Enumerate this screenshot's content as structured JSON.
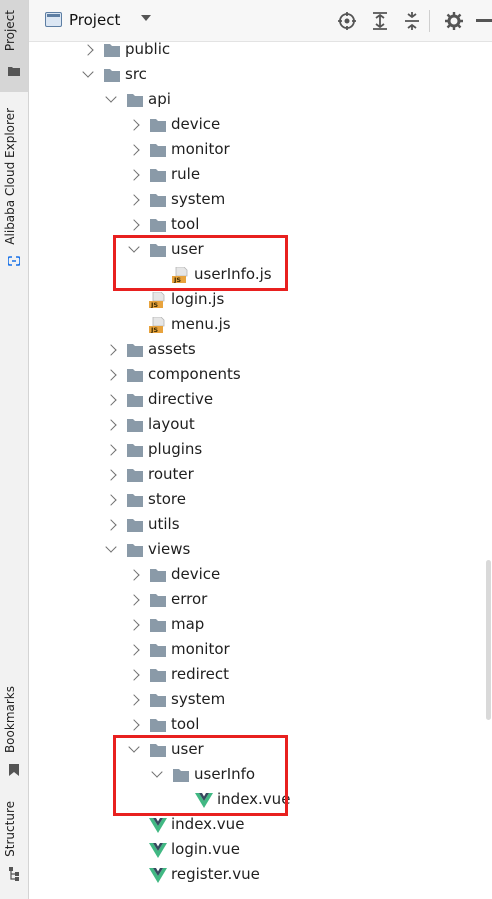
{
  "sidebar": {
    "tabs": [
      {
        "label": "Project",
        "icon": "folder-icon",
        "active": true
      },
      {
        "label": "Alibaba Cloud Explorer",
        "icon": "alibaba-cloud-icon",
        "active": false
      },
      {
        "label": "Bookmarks",
        "icon": "bookmark-icon",
        "active": false
      },
      {
        "label": "Structure",
        "icon": "structure-icon",
        "active": false
      }
    ]
  },
  "header": {
    "title": "Project",
    "actions": [
      "locate-icon",
      "expand-all-icon",
      "collapse-all-icon",
      "settings-icon",
      "hide-icon"
    ]
  },
  "colors": {
    "folder": "#8a9aa8",
    "vue": "#41b883",
    "vue_dark": "#35495e",
    "js_badge": "#e8a33d",
    "highlight": "#e8201f"
  },
  "tree": [
    {
      "label": "public",
      "type": "folder",
      "depth": 0,
      "state": "collapsed"
    },
    {
      "label": "src",
      "type": "folder",
      "depth": 0,
      "state": "expanded"
    },
    {
      "label": "api",
      "type": "folder",
      "depth": 1,
      "state": "expanded"
    },
    {
      "label": "device",
      "type": "folder",
      "depth": 2,
      "state": "collapsed"
    },
    {
      "label": "monitor",
      "type": "folder",
      "depth": 2,
      "state": "collapsed"
    },
    {
      "label": "rule",
      "type": "folder",
      "depth": 2,
      "state": "collapsed"
    },
    {
      "label": "system",
      "type": "folder",
      "depth": 2,
      "state": "collapsed"
    },
    {
      "label": "tool",
      "type": "folder",
      "depth": 2,
      "state": "collapsed"
    },
    {
      "label": "user",
      "type": "folder",
      "depth": 2,
      "state": "expanded"
    },
    {
      "label": "userInfo.js",
      "type": "js",
      "depth": 3,
      "state": "none"
    },
    {
      "label": "login.js",
      "type": "js",
      "depth": 2,
      "state": "none"
    },
    {
      "label": "menu.js",
      "type": "js",
      "depth": 2,
      "state": "none"
    },
    {
      "label": "assets",
      "type": "folder",
      "depth": 1,
      "state": "collapsed"
    },
    {
      "label": "components",
      "type": "folder",
      "depth": 1,
      "state": "collapsed"
    },
    {
      "label": "directive",
      "type": "folder",
      "depth": 1,
      "state": "collapsed"
    },
    {
      "label": "layout",
      "type": "folder",
      "depth": 1,
      "state": "collapsed"
    },
    {
      "label": "plugins",
      "type": "folder",
      "depth": 1,
      "state": "collapsed"
    },
    {
      "label": "router",
      "type": "folder",
      "depth": 1,
      "state": "collapsed"
    },
    {
      "label": "store",
      "type": "folder",
      "depth": 1,
      "state": "collapsed"
    },
    {
      "label": "utils",
      "type": "folder",
      "depth": 1,
      "state": "collapsed"
    },
    {
      "label": "views",
      "type": "folder",
      "depth": 1,
      "state": "expanded"
    },
    {
      "label": "device",
      "type": "folder",
      "depth": 2,
      "state": "collapsed"
    },
    {
      "label": "error",
      "type": "folder",
      "depth": 2,
      "state": "collapsed"
    },
    {
      "label": "map",
      "type": "folder",
      "depth": 2,
      "state": "collapsed"
    },
    {
      "label": "monitor",
      "type": "folder",
      "depth": 2,
      "state": "collapsed"
    },
    {
      "label": "redirect",
      "type": "folder",
      "depth": 2,
      "state": "collapsed"
    },
    {
      "label": "system",
      "type": "folder",
      "depth": 2,
      "state": "collapsed"
    },
    {
      "label": "tool",
      "type": "folder",
      "depth": 2,
      "state": "collapsed"
    },
    {
      "label": "user",
      "type": "folder",
      "depth": 2,
      "state": "expanded"
    },
    {
      "label": "userInfo",
      "type": "folder",
      "depth": 3,
      "state": "expanded"
    },
    {
      "label": "index.vue",
      "type": "vue",
      "depth": 4,
      "state": "none"
    },
    {
      "label": "index.vue",
      "type": "vue",
      "depth": 2,
      "state": "none"
    },
    {
      "label": "login.vue",
      "type": "vue",
      "depth": 2,
      "state": "none"
    },
    {
      "label": "register.vue",
      "type": "vue",
      "depth": 2,
      "state": "none"
    }
  ],
  "highlighted_rows": [
    [
      8,
      9
    ],
    [
      28,
      30
    ]
  ]
}
